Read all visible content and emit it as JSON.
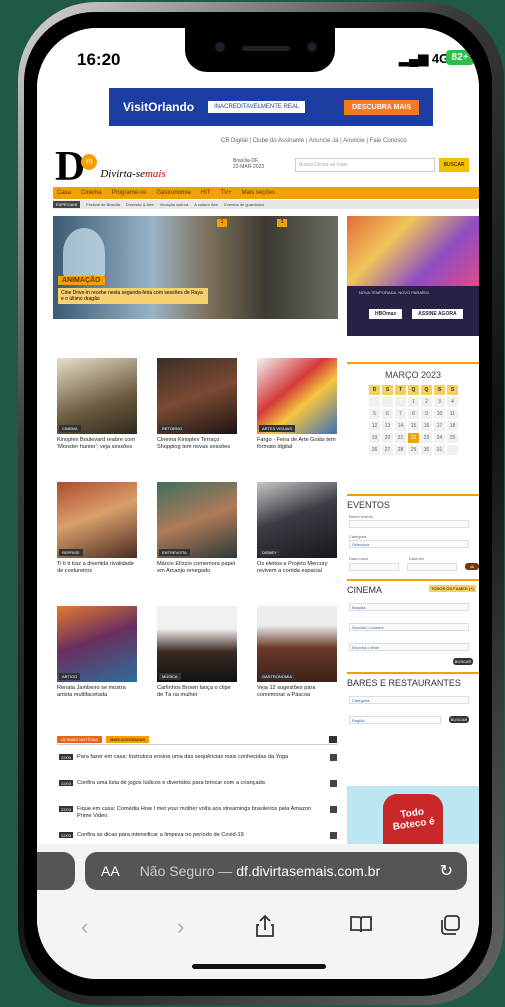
{
  "status": {
    "time": "16:20",
    "signal": "4G",
    "battery": "82+"
  },
  "ad_top": {
    "brand": "VisitOrlando",
    "tagline": "INACREDITAVELMENTE REAL",
    "cta": "DESCUBRA MAIS"
  },
  "site": {
    "top_links": "CB Digital  |  Clube do Assinante  |  Anuncie Já  |  Anuncie  |  Fale Conosco",
    "logo_letter": "D",
    "logo_m": "m",
    "logo_text1": "Divirta-se",
    "logo_text2": "mais",
    "date_line1": "Brasília-DF,",
    "date_line2": "22-MAR-2023",
    "search_placeholder": "Busca Divirta-se mais",
    "search_button": "BUSCAR",
    "nav": [
      "Casa",
      "Cinema",
      "Programe-se",
      "Gastronomia",
      "HIT",
      "TV+",
      "Mais seções"
    ],
    "subnav": [
      "ESPECIAIS",
      "Festival de Brasília",
      "Diversão & Arte",
      "Vocação cultura",
      "A cultura livre",
      "Eventos de guardados"
    ]
  },
  "hero": {
    "tag": "ANIMAÇÃO",
    "caption": "Cine Drive-in recebe nesta segunda-feira com sessões de Raya e o último dragão",
    "nums": [
      "1",
      "3"
    ]
  },
  "cards": [
    {
      "label": "CINEMA",
      "caption": "Kinoplex Boulevard reabre com 'Monster hunter'; veja sessões"
    },
    {
      "label": "RETORNO",
      "caption": "Cinema Kinoplex Terraço Shopping tem novas sessões"
    },
    {
      "label": "ARTES VISUAIS",
      "caption": "Fargo - Feira de Arte Goiás tem formato digital"
    },
    {
      "label": "REPRISE",
      "caption": "Ti ti ti traz a divertida rivalidade de costureiros"
    },
    {
      "label": "ENTREVISTA",
      "caption": "Márcio Elízzio comemora papel em Arcanjo renegado"
    },
    {
      "label": "DISNEY",
      "caption": "Os eleitos e Projeto Mercury revivem a corrida espacial"
    },
    {
      "label": "ARTIGO",
      "caption": "Renata Jambeiro se mostra artista multifacetada"
    },
    {
      "label": "MÚSICA",
      "caption": "Carlinhos Brown lança o clipe de Tá na mulher"
    },
    {
      "label": "GASTRONOMIA",
      "caption": "Veja 12 sugestões para comemorar a Páscoa"
    }
  ],
  "side_ad": {
    "brand": "HBOmax",
    "button": "ASSINE AGORA",
    "text": "NOVA TEMPORADA. NOVO PARAÍSO."
  },
  "calendar": {
    "month": "MARÇO 2023",
    "weekdays": [
      "D",
      "S",
      "T",
      "Q",
      "Q",
      "S",
      "S"
    ],
    "days": [
      "",
      "",
      "",
      "1",
      "2",
      "3",
      "4",
      "5",
      "6",
      "7",
      "8",
      "9",
      "10",
      "11",
      "12",
      "13",
      "14",
      "15",
      "16",
      "17",
      "18",
      "19",
      "20",
      "21",
      "22",
      "23",
      "24",
      "25",
      "26",
      "27",
      "28",
      "29",
      "30",
      "31",
      ""
    ],
    "today": "22"
  },
  "eventos": {
    "title": "EVENTOS",
    "f1": "Nome evento",
    "f2": "Categoria",
    "f3": "Selecione",
    "f4": "Data início",
    "f5": "Data fim",
    "go": "ok"
  },
  "cinema": {
    "title": "CINEMA",
    "badge": "TODOS OS FILMES (+)",
    "fields": [
      "Brasília",
      "Escolha o cinema",
      "Escolha o filme"
    ],
    "button": "BUSCAR"
  },
  "bares": {
    "title": "BARES E RESTAURANTES",
    "fields": [
      "Categoria",
      "Região"
    ],
    "button": "BUSCAR"
  },
  "bottom_ad": {
    "text": "Todo Boteco é"
  },
  "news_tabs": [
    "ÚLTIMAS NOTÍCIAS",
    "MAIS ACESSADAS"
  ],
  "news": [
    {
      "date": "22/03",
      "text": "Para fazer em casa: Instrutora ensina uma das sequências mais conhecidas da Yoga"
    },
    {
      "date": "22/03",
      "text": "Confira uma lista de jogos lúdicos e divertidos para brincar com a criançada"
    },
    {
      "date": "22/03",
      "text": "Fique em casa: Comédia How I met your mother volta aos streamings brasileiros pela Amazon Prime Video"
    },
    {
      "date": "22/03",
      "text": "Confira as dicas para intensificar a limpeza no período de Covid-19"
    }
  ],
  "browser": {
    "aa": "AA",
    "security": "Não Seguro —",
    "url": "df.divirtasemais.com.br"
  }
}
